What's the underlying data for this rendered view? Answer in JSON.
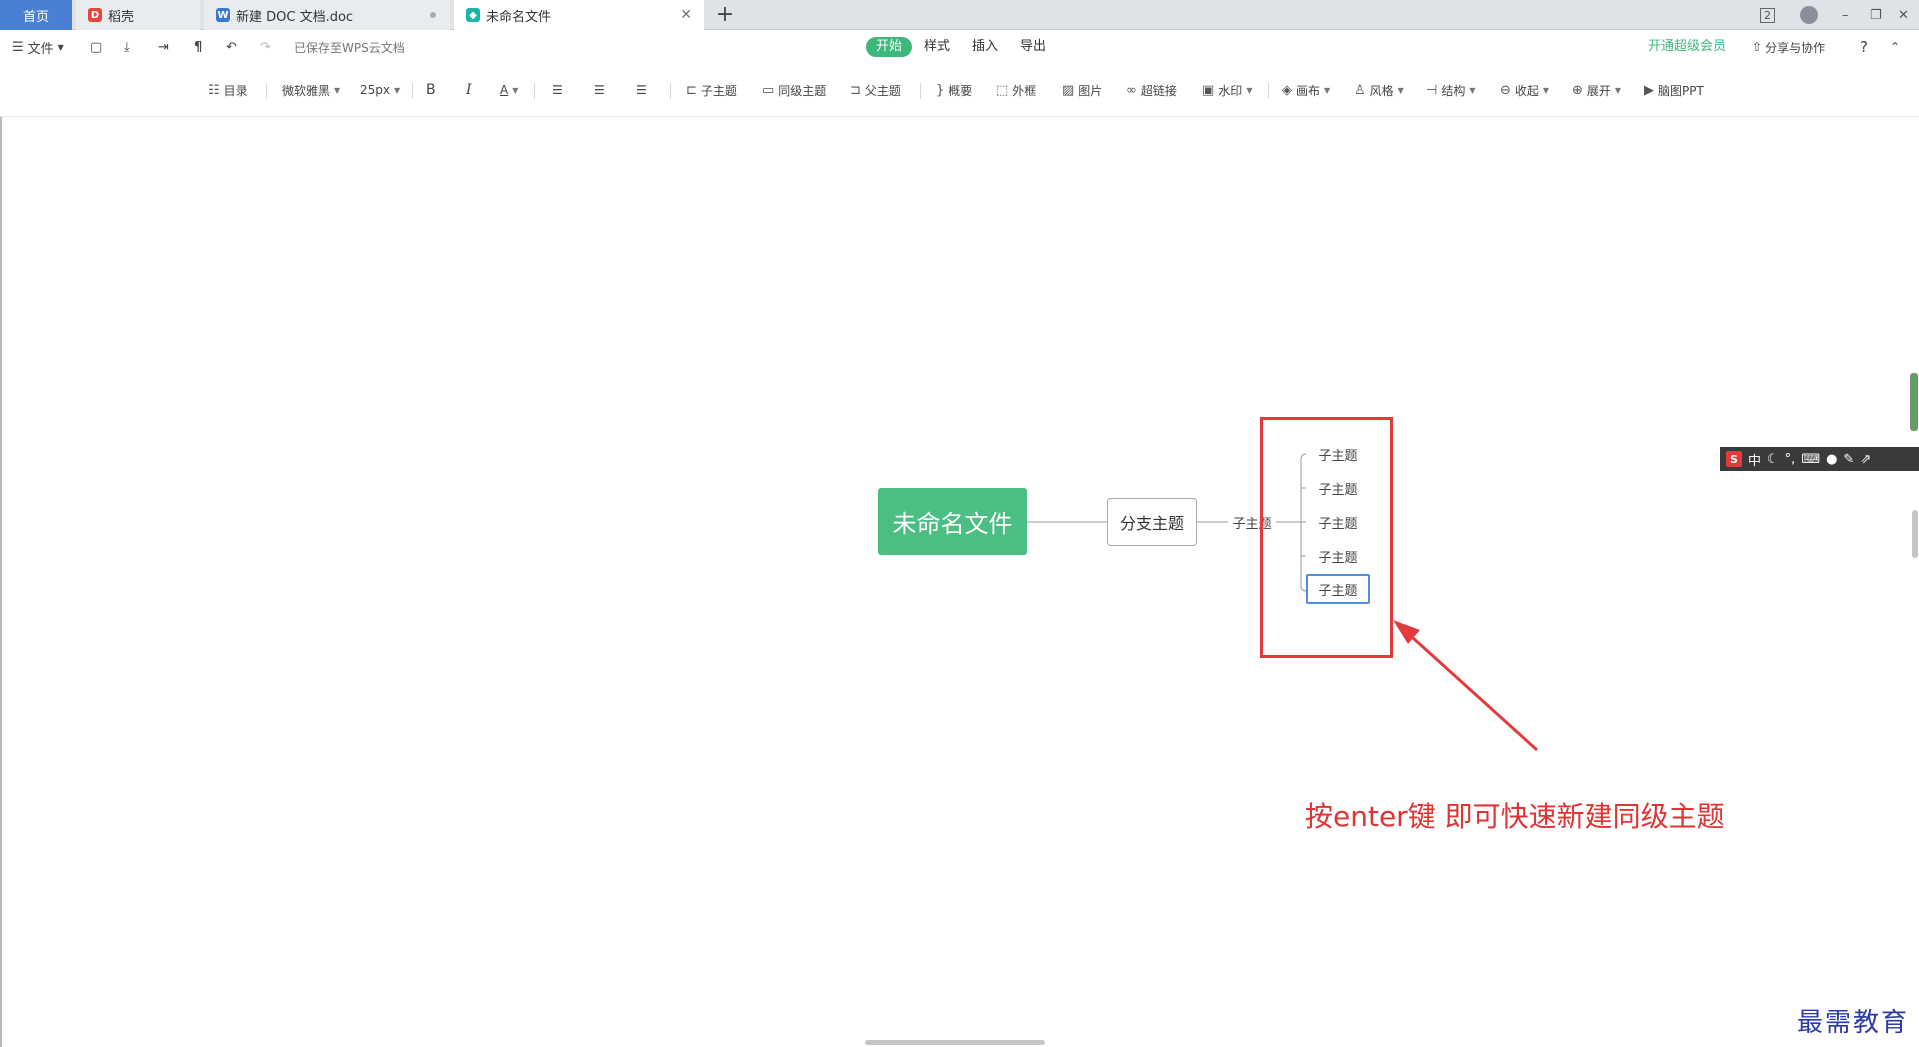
{
  "tabs": {
    "home": "首页",
    "tab1": "稻壳",
    "tab2": "新建 DOC 文档.doc",
    "tab3": "未命名文件",
    "new_tab": "+"
  },
  "window": {
    "badge": "2",
    "minimize": "–",
    "restore": "❐",
    "close": "✕"
  },
  "ribbon": {
    "file_menu": "文件",
    "saved_status": "已保存至WPS云文档",
    "tabs": [
      "开始",
      "样式",
      "插入",
      "导出"
    ],
    "active_tab": "开始",
    "vip": "开通超级会员",
    "share": "分享与协作",
    "help": "?"
  },
  "toolbar": {
    "outline": "目录",
    "font_family": "微软雅黑",
    "font_size": "25px",
    "bold": "B",
    "italic": "I",
    "font_color": "A",
    "child_topic": "子主题",
    "sibling_topic": "同级主题",
    "parent_topic": "父主题",
    "summary": "概要",
    "frame": "外框",
    "image": "图片",
    "hyperlink": "超链接",
    "watermark": "水印",
    "canvas": "画布",
    "style": "风格",
    "structure": "结构",
    "collapse": "收起",
    "expand": "展开",
    "mindmap_ppt": "脑图PPT"
  },
  "mindmap": {
    "root": "未命名文件",
    "branch": "分支主题",
    "subtopic": "子主题",
    "leaves": [
      "子主题",
      "子主题",
      "子主题",
      "子主题",
      "子主题"
    ]
  },
  "annotation": "按enter键 即可快速新建同级主题",
  "watermark_brand": "最需教育",
  "ime": {
    "logo": "S",
    "mode": "中"
  },
  "colors": {
    "accent_green": "#3eb87a",
    "root_node": "#4bbf83",
    "annotation_red": "#e03333",
    "selection_blue": "#4f8fe0"
  }
}
